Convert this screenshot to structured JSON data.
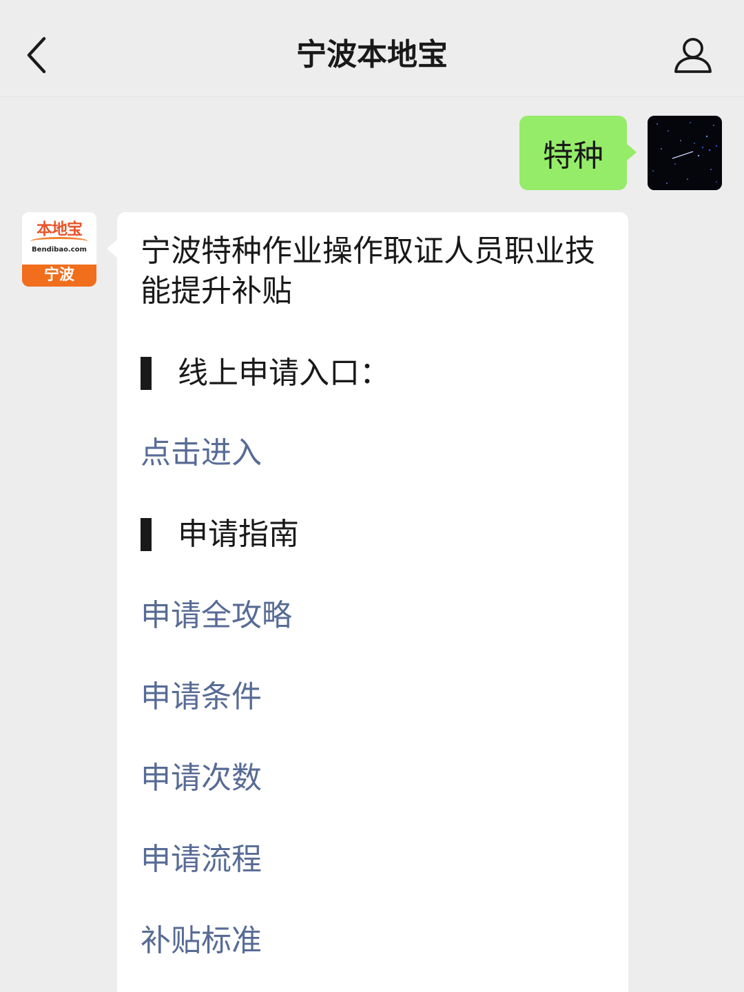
{
  "header": {
    "title": "宁波本地宝"
  },
  "outgoing_message": {
    "text": "特种"
  },
  "incoming_message": {
    "avatar": {
      "brand": "本地宝",
      "domain": "Bendibao.com",
      "city": "宁波"
    },
    "title": "宁波特种作业操作取证人员职业技能提升补贴",
    "section_online": "线上申请入口：",
    "link_enter": "点击进入",
    "section_guide": "申请指南",
    "guide_links": [
      "申请全攻略",
      "申请条件",
      "申请次数",
      "申请流程",
      "补贴标准"
    ]
  },
  "colors": {
    "background": "#ededed",
    "bubble_outgoing": "#95ec69",
    "bubble_incoming": "#ffffff",
    "link": "#576b95",
    "brand_orange": "#f06e1c"
  },
  "icons": {
    "back": "chevron-left-icon",
    "profile": "person-icon"
  }
}
